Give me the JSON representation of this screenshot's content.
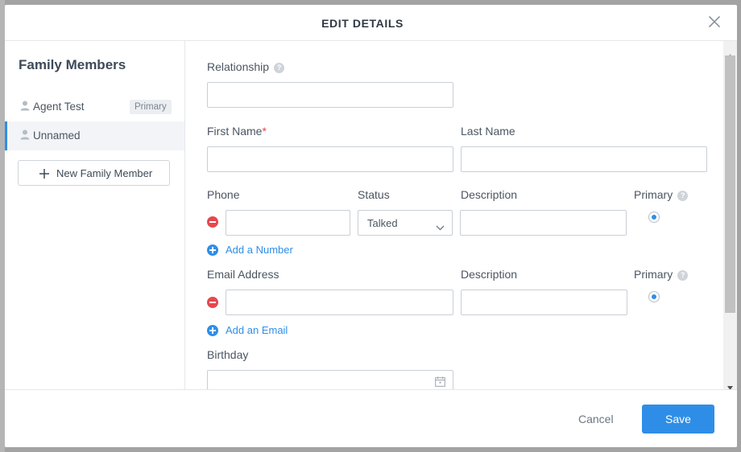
{
  "modal": {
    "title": "EDIT DETAILS"
  },
  "sidebar": {
    "title": "Family Members",
    "members": [
      {
        "name": "Agent Test",
        "tag": "Primary",
        "active": false
      },
      {
        "name": "Unnamed",
        "active": true
      }
    ],
    "new_member_label": "New Family Member"
  },
  "form": {
    "relationship": {
      "label": "Relationship",
      "value": ""
    },
    "first_name": {
      "label": "First Name",
      "required_mark": "*",
      "value": ""
    },
    "last_name": {
      "label": "Last Name",
      "value": ""
    },
    "phone": {
      "label": "Phone",
      "status_label": "Status",
      "description_label": "Description",
      "primary_label": "Primary",
      "value": "",
      "status_value": "Talked",
      "description_value": "",
      "add_label": "Add a Number"
    },
    "email": {
      "label": "Email Address",
      "description_label": "Description",
      "primary_label": "Primary",
      "value": "",
      "description_value": "",
      "add_label": "Add an Email"
    },
    "birthday": {
      "label": "Birthday",
      "value": ""
    },
    "help_glyph": "?"
  },
  "footer": {
    "cancel_label": "Cancel",
    "save_label": "Save"
  },
  "colors": {
    "accent": "#2e8ee7",
    "danger": "#e5484d",
    "text": "#3d4a58"
  }
}
